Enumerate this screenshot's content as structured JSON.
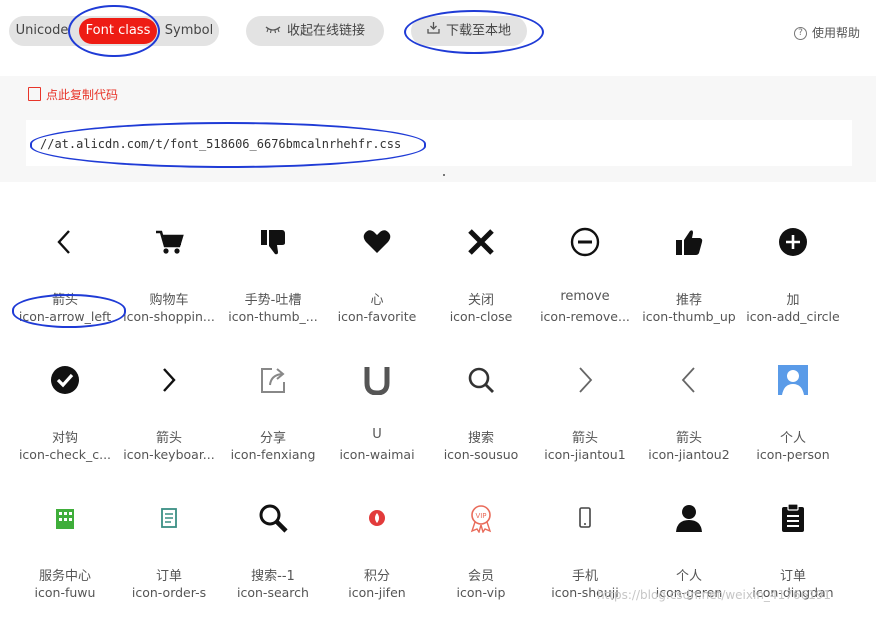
{
  "toolbar": {
    "tab_unicode": "Unicode",
    "tab_font_class": "Font class",
    "tab_symbol": "Symbol",
    "collapse_label": "收起在线链接",
    "download_label": "下载至本地",
    "help_label": "使用帮助"
  },
  "code": {
    "copy_label": "点此复制代码",
    "url": "//at.alicdn.com/t/font_518606_6676bmcalnrhehfr.css"
  },
  "colors": {
    "accent": "#ee1c14",
    "annotation": "#1f3bd6",
    "link": "#e8352a"
  },
  "icons": [
    {
      "name": "箭头",
      "cls": "icon-arrow_left",
      "icon": "chevron-left-icon"
    },
    {
      "name": "购物车",
      "cls": "icon-shoppin...",
      "icon": "shopping-cart-icon"
    },
    {
      "name": "手势-吐槽",
      "cls": "icon-thumb_...",
      "icon": "thumb-down-icon"
    },
    {
      "name": "心",
      "cls": "icon-favorite",
      "icon": "heart-icon"
    },
    {
      "name": "关闭",
      "cls": "icon-close",
      "icon": "close-icon"
    },
    {
      "name": "remove",
      "cls": "icon-remove...",
      "icon": "remove-circle-icon"
    },
    {
      "name": "推荐",
      "cls": "icon-thumb_up",
      "icon": "thumb-up-icon"
    },
    {
      "name": "加",
      "cls": "icon-add_circle",
      "icon": "add-circle-icon"
    },
    {
      "name": "对钩",
      "cls": "icon-check_c...",
      "icon": "check-circle-icon"
    },
    {
      "name": "箭头",
      "cls": "icon-keyboar...",
      "icon": "chevron-right-icon"
    },
    {
      "name": "分享",
      "cls": "icon-fenxiang",
      "icon": "share-icon"
    },
    {
      "name": "U",
      "cls": "icon-waimai",
      "icon": "u-letter-icon"
    },
    {
      "name": "搜索",
      "cls": "icon-sousuo",
      "icon": "search-icon"
    },
    {
      "name": "箭头",
      "cls": "icon-jiantou1",
      "icon": "thin-chevron-right-icon"
    },
    {
      "name": "箭头",
      "cls": "icon-jiantou2",
      "icon": "thin-chevron-left-icon"
    },
    {
      "name": "个人",
      "cls": "icon-person",
      "icon": "person-square-icon"
    },
    {
      "name": "服务中心",
      "cls": "icon-fuwu",
      "icon": "building-icon"
    },
    {
      "name": "订单",
      "cls": "icon-order-s",
      "icon": "order-document-icon"
    },
    {
      "name": "搜索--1",
      "cls": "icon-search",
      "icon": "search-bold-icon"
    },
    {
      "name": "积分",
      "cls": "icon-jifen",
      "icon": "points-icon"
    },
    {
      "name": "会员",
      "cls": "icon-vip",
      "icon": "vip-badge-icon"
    },
    {
      "name": "手机",
      "cls": "icon-shouji",
      "icon": "phone-icon"
    },
    {
      "name": "个人",
      "cls": "icon-geren",
      "icon": "user-icon"
    },
    {
      "name": "订单",
      "cls": "icon-dingdan",
      "icon": "clipboard-icon"
    }
  ],
  "watermark": "https://blog.csdn.net/weixin_41766191"
}
